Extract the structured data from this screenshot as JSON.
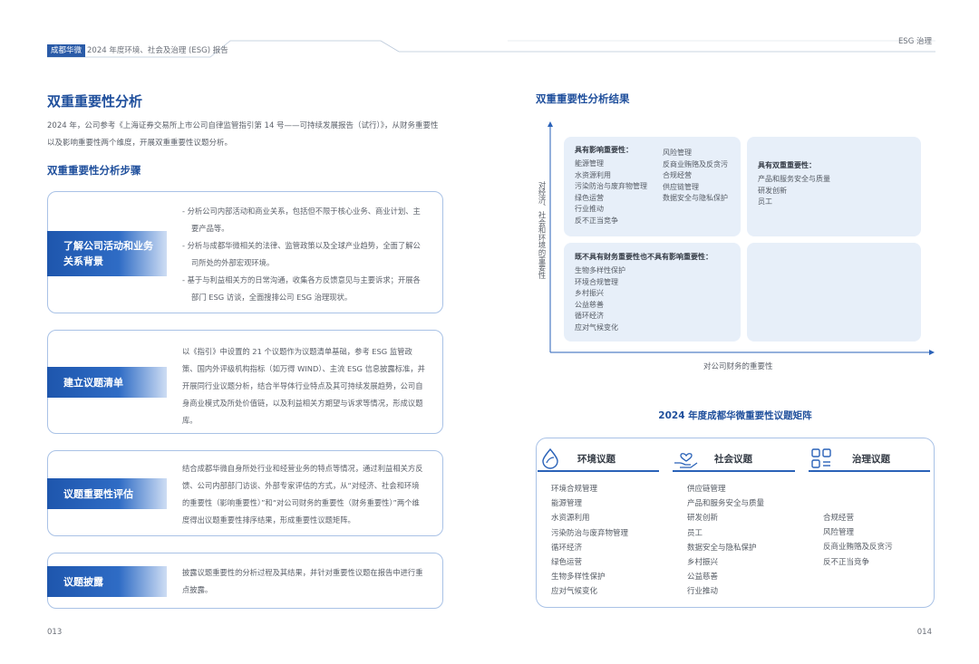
{
  "header": {
    "company_tag": "成都华微",
    "report_title": "2024 年度环境、社会及治理 (ESG) 报告",
    "section_tag": "ESG 治理"
  },
  "left": {
    "title": "双重重要性分析",
    "intro": "2024 年，公司参考《上海证券交易所上市公司自律监管指引第 14 号——可持续发展报告（试行）》，从财务重要性以及影响重要性两个维度，开展双重重要性议题分析。",
    "steps_title": "双重重要性分析步骤",
    "steps": [
      {
        "label": "了解公司活动和业务关系背景",
        "paragraphs": [
          "- 分析公司内部活动和商业关系，包括但不限于核心业务、商业计划、主要产品等。",
          "- 分析与成都华微相关的法律、监管政策以及全球产业趋势，全面了解公司所处的外部宏观环境。",
          "- 基于与利益相关方的日常沟通，收集各方反馈意见与主要诉求；开展各部门 ESG 访谈，全面搜排公司 ESG 治理现状。"
        ]
      },
      {
        "label": "建立议题清单",
        "paragraphs": [
          "以《指引》中设置的 21 个议题作为议题清单基础，参考 ESG 监管政策、国内外评级机构指标（如万得 WIND）、主流 ESG 信息披露标准，并开展同行业议题分析，结合半导体行业特点及其可持续发展趋势，公司自身商业模式及所处价值链，以及利益相关方期望与诉求等情况，形成议题库。"
        ]
      },
      {
        "label": "议题重要性评估",
        "paragraphs": [
          "结合成都华微自身所处行业和经营业务的特点等情况，通过利益相关方反馈、公司内部部门访谈、外部专家评估的方式，从“对经济、社会和环境的重要性（影响重要性）”和“对公司财务的重要性（财务重要性）”两个维度得出议题重要性排序结果，形成重要性议题矩阵。"
        ]
      },
      {
        "label": "议题披露",
        "paragraphs": [
          "披露议题重要性的分析过程及其结果，并针对重要性议题在报告中进行重点披露。"
        ]
      }
    ],
    "page_number": "013"
  },
  "right": {
    "title": "双重重要性分析结果",
    "y_axis_label": "对经济、社会和环境的重要性",
    "x_axis_label": "对公司财务的重要性",
    "quadrants": {
      "impact": {
        "title": "具有影响重要性：",
        "col1": [
          "能源管理",
          "水资源利用",
          "污染防治与废弃物管理",
          "绿色运营",
          "行业推动",
          "反不正当竞争"
        ],
        "col2": [
          "风险管理",
          "反商业贿赂及反贪污",
          "合规经营",
          "供应链管理",
          "数据安全与隐私保护"
        ]
      },
      "double": {
        "title": "具有双重重要性：",
        "items": [
          "产品和服务安全与质量",
          "研发创新",
          "员工"
        ]
      },
      "neither": {
        "title": "既不具有财务重要性也不具有影响重要性：",
        "items": [
          "生物多样性保护",
          "环境合规管理",
          "乡村振兴",
          "公益慈善",
          "循环经济",
          "应对气候变化"
        ]
      }
    },
    "matrix_title": "2024 年度成都华微重要性议题矩阵",
    "categories": [
      {
        "name": "环境议题",
        "icon": "leaf-drop-icon",
        "items": [
          "环境合规管理",
          "能源管理",
          "水资源利用",
          "污染防治与废弃物管理",
          "循环经济",
          "绿色运营",
          "生物多样性保护",
          "应对气候变化"
        ]
      },
      {
        "name": "社会议题",
        "icon": "heart-hand-icon",
        "items": [
          "供应链管理",
          "产品和服务安全与质量",
          "研发创新",
          "员工",
          "数据安全与隐私保护",
          "乡村振兴",
          "公益慈善",
          "行业推动"
        ]
      },
      {
        "name": "治理议题",
        "icon": "grid-apps-icon",
        "items": [
          "合规经营",
          "风险管理",
          "反商业贿赂及反贪污",
          "反不正当竞争"
        ]
      }
    ],
    "page_number": "014"
  },
  "colors": {
    "accent_blue": "#1f4f9c",
    "box_border": "#a9c2e6",
    "quadrant_fill": "#e7eff9"
  }
}
